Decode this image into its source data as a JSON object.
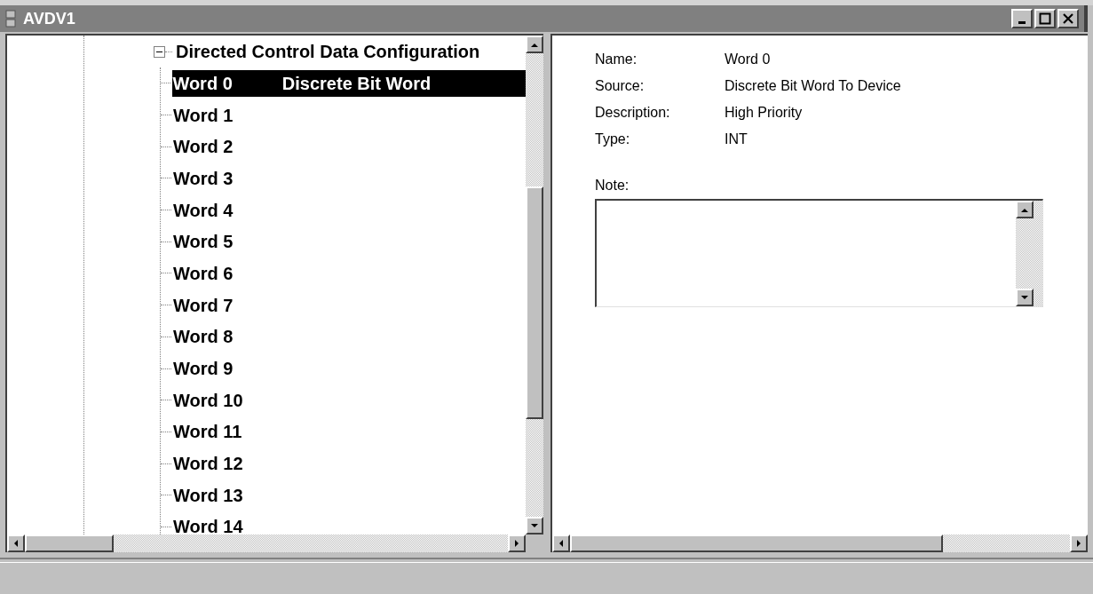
{
  "window": {
    "title": "AVDV1"
  },
  "tree": {
    "root": {
      "label": "Directed Control Data Configuration",
      "expanded": true
    },
    "children": [
      {
        "label": "Word 0",
        "detail": "Discrete Bit Word",
        "selected": true
      },
      {
        "label": "Word 1",
        "selected": false
      },
      {
        "label": "Word 2",
        "selected": false
      },
      {
        "label": "Word 3",
        "selected": false
      },
      {
        "label": "Word 4",
        "selected": false
      },
      {
        "label": "Word 5",
        "selected": false
      },
      {
        "label": "Word 6",
        "selected": false
      },
      {
        "label": "Word 7",
        "selected": false
      },
      {
        "label": "Word 8",
        "selected": false
      },
      {
        "label": "Word 9",
        "selected": false
      },
      {
        "label": "Word 10",
        "selected": false
      },
      {
        "label": "Word 11",
        "selected": false
      },
      {
        "label": "Word 12",
        "selected": false
      },
      {
        "label": "Word 13",
        "selected": false
      },
      {
        "label": "Word 14",
        "selected": false
      }
    ]
  },
  "details": {
    "fields": [
      {
        "label": "Name:",
        "value": "Word 0"
      },
      {
        "label": "Source:",
        "value": "Discrete Bit Word To Device"
      },
      {
        "label": "Description:",
        "value": "High Priority"
      },
      {
        "label": "Type:",
        "value": "INT"
      }
    ],
    "note": {
      "label": "Note:"
    }
  }
}
